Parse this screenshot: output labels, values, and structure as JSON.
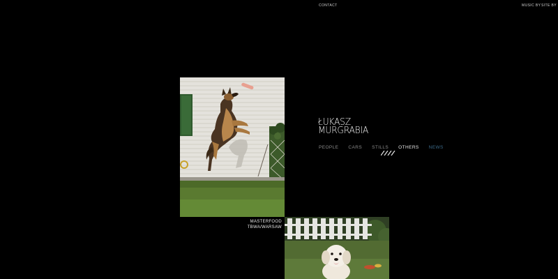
{
  "header": {
    "contact_label": "CONTACT",
    "music_by_label": "MUSIC BY",
    "site_by_label": "SITE BY"
  },
  "logo": {
    "line1": "ŁUKASZ",
    "line2": "MURGRABIA"
  },
  "nav": {
    "items": [
      {
        "label": "PEOPLE"
      },
      {
        "label": "CARS"
      },
      {
        "label": "STILLS"
      },
      {
        "label": "OTHERS"
      },
      {
        "label": "NEWS"
      }
    ],
    "active_index": 3
  },
  "gallery": {
    "caption": {
      "line1": "MASTERFOOD",
      "line2": "TBWA/WARSAW"
    }
  },
  "colors": {
    "background": "#000000",
    "nav_inactive": "#8a8a8a",
    "nav_active": "#e8e8e8",
    "nav_news": "#3c6b8a"
  }
}
